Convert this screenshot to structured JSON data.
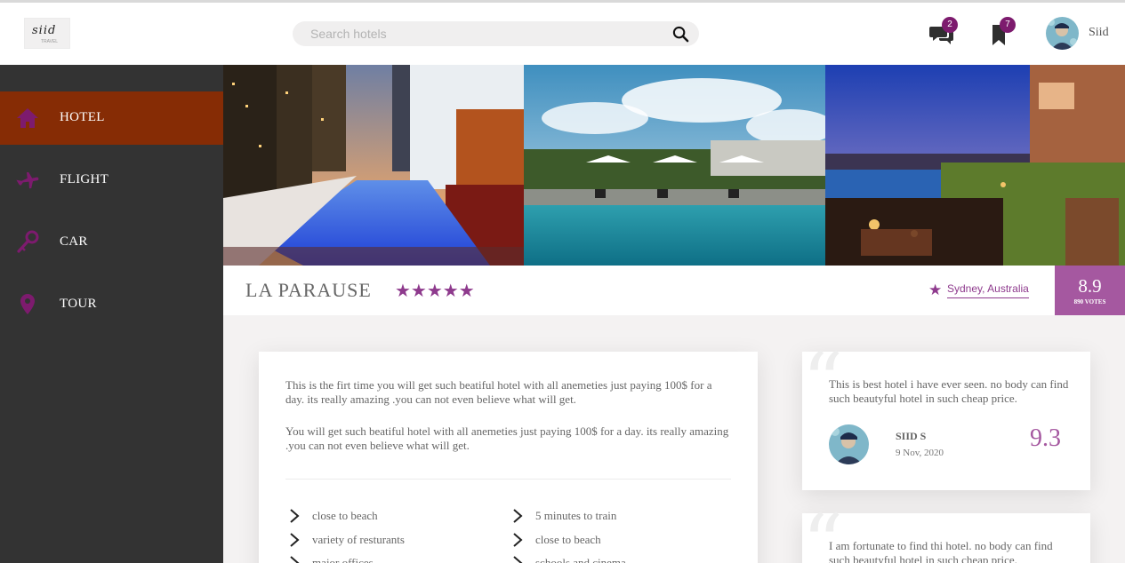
{
  "header": {
    "logo_text": "siid",
    "logo_sub": "TRAVEL",
    "search_placeholder": "Search hotels",
    "messages_count": "2",
    "bookmarks_count": "7",
    "user_name": "Siid"
  },
  "sidebar": {
    "items": [
      {
        "label": "HOTEL",
        "icon": "home-icon",
        "active": true
      },
      {
        "label": "FLIGHT",
        "icon": "airplane-icon",
        "active": false
      },
      {
        "label": "CAR",
        "icon": "key-icon",
        "active": false
      },
      {
        "label": "TOUR",
        "icon": "map-pin-icon",
        "active": false
      }
    ]
  },
  "hotel": {
    "name": "LA PARAUSE",
    "stars": "★★★★★",
    "star_rating": 5,
    "location": "Sydney, Australia",
    "score": "8.9",
    "votes": "890 VOTES"
  },
  "description": {
    "para1": "This is the firt time you will get such beatiful hotel with all anemeties just paying 100$ for a day. its really amazing .you can not even believe what will get.",
    "para2": "You will get such beatiful hotel with all anemeties just paying 100$ for a day. its really amazing .you can not even believe what will get.",
    "features_left": [
      "close to beach",
      "variety of resturants",
      "major offices"
    ],
    "features_right": [
      "5 minutes to train",
      "close to beach",
      "schools and cinema"
    ]
  },
  "reviews": [
    {
      "text": "This is best hotel i have ever seen. no body can find such beautyful hotel in such cheap price.",
      "name": "SIID S",
      "date": "9 Nov, 2020",
      "score": "9.3"
    },
    {
      "text": "I am fortunate to find thi hotel. no body can find such beautyful hotel in such cheap price."
    }
  ],
  "colors": {
    "accent": "#a558a0",
    "sidebar_bg": "#333333",
    "sidebar_active": "#862c05",
    "icon_purple": "#7d1b6e"
  }
}
